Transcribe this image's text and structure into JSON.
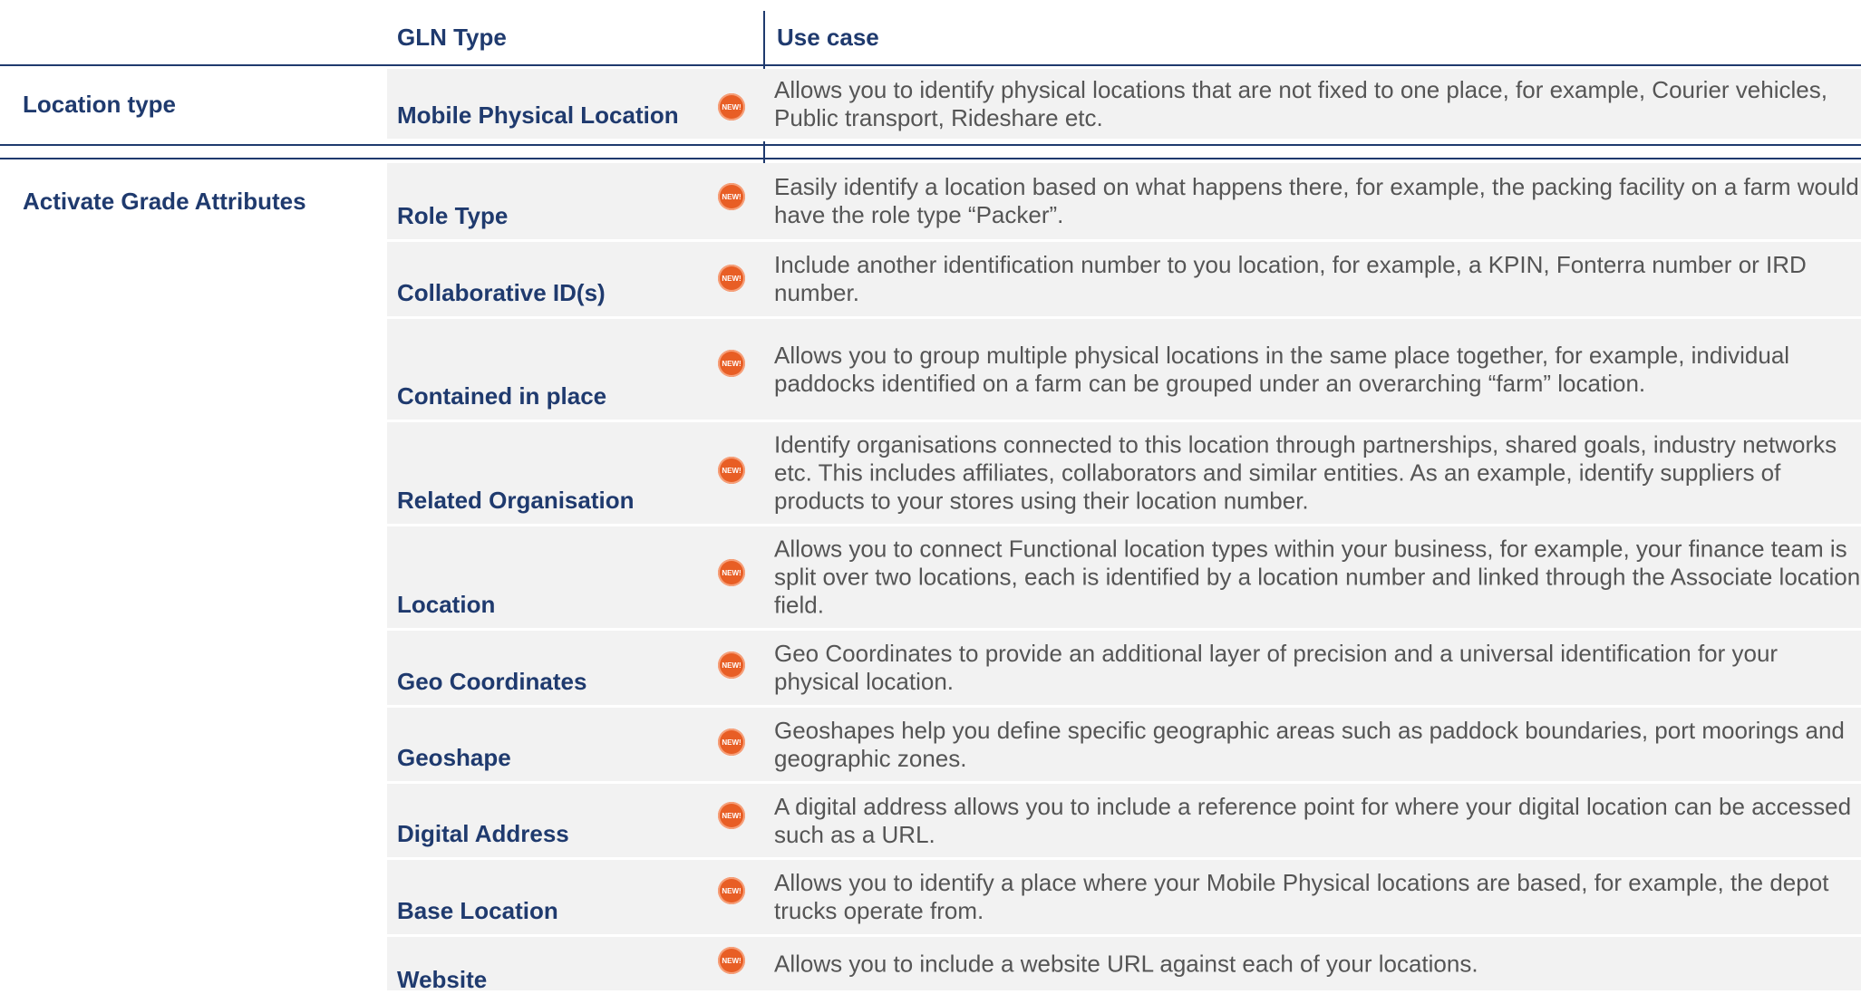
{
  "header": {
    "gln_type": "GLN Type",
    "use_case": "Use case"
  },
  "sections": [
    {
      "label": "Location type",
      "rows": [
        {
          "name": "Mobile Physical Location",
          "badge": "NEW!",
          "description": "Allows you to identify physical locations that are not fixed to one place, for example, Courier vehicles, Public transport, Rideshare etc."
        }
      ]
    },
    {
      "label": "Activate Grade Attributes",
      "rows": [
        {
          "name": "Role Type",
          "badge": "NEW!",
          "description": "Easily identify a location based on what happens there, for example, the packing facility on a farm would have the role type “Packer”."
        },
        {
          "name": "Collaborative ID(s)",
          "badge": "NEW!",
          "description": "Include another identification number to you location, for example, a KPIN, Fonterra number or IRD number."
        },
        {
          "name": "Contained in place",
          "badge": "NEW!",
          "description": "Allows you to group multiple physical locations in the same place together, for example, individual paddocks identified on a farm can be grouped under an overarching “farm” location."
        },
        {
          "name": "Related Organisation",
          "badge": "NEW!",
          "description": "Identify organisations connected to this location through partnerships, shared goals, industry networks etc. This includes affiliates, collaborators and similar entities. As an example, identify suppliers of products to your stores using their location number."
        },
        {
          "name": "Location",
          "badge": "NEW!",
          "description": "Allows you to connect Functional location types within your business, for example, your finance team is split over two locations, each is identified by a location number and linked through the Associate location field."
        },
        {
          "name": "Geo Coordinates",
          "badge": "NEW!",
          "description": "Geo Coordinates to provide an additional layer of precision and a universal identification for your physical location."
        },
        {
          "name": "Geoshape",
          "badge": "NEW!",
          "description": "Geoshapes help you define specific geographic areas such as paddock boundaries, port moorings and geographic zones."
        },
        {
          "name": "Digital Address",
          "badge": "NEW!",
          "description": "A digital address allows you to include a reference point for where your digital location can be accessed such as a URL."
        },
        {
          "name": "Base Location",
          "badge": "NEW!",
          "description": "Allows you to identify a place where your Mobile Physical locations are based, for example, the depot trucks operate from."
        },
        {
          "name": "Website",
          "badge": "NEW!",
          "description": "Allows you to include a website URL against each of your locations."
        }
      ]
    }
  ],
  "colors": {
    "heading": "#1f3a6e",
    "body_text": "#555555",
    "row_bg": "#f2f2f2",
    "badge": "#e85e25"
  }
}
